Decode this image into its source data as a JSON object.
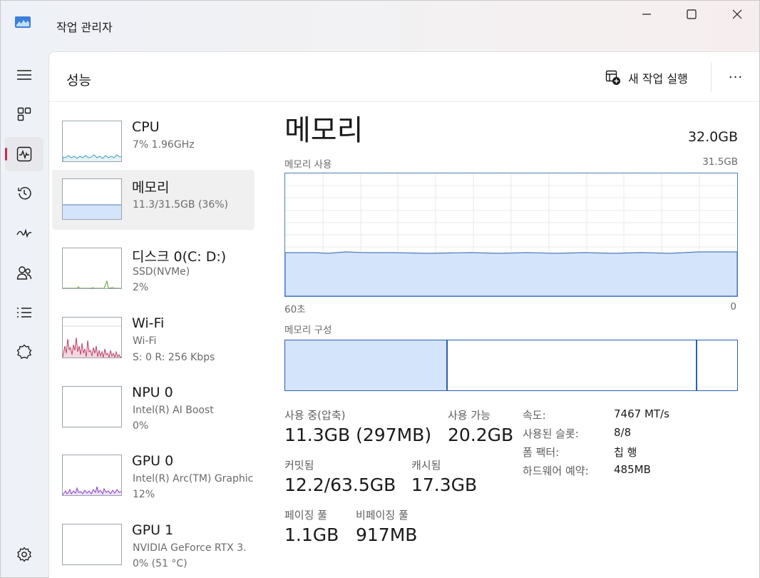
{
  "window": {
    "title": "작업 관리자",
    "colors": {
      "accent": "#c42b4d",
      "memory_line": "#4c7cbf",
      "memory_fill": "#d4e4fa"
    }
  },
  "nav": {
    "items": [
      {
        "icon": "hamburger-menu-icon"
      },
      {
        "icon": "processes-icon"
      },
      {
        "icon": "performance-icon",
        "active": true
      },
      {
        "icon": "app-history-icon"
      },
      {
        "icon": "startup-apps-icon"
      },
      {
        "icon": "users-icon"
      },
      {
        "icon": "details-icon"
      },
      {
        "icon": "services-icon"
      },
      {
        "icon": "settings-icon"
      }
    ]
  },
  "header": {
    "title": "성능",
    "run_task_label": "새 작업 실행",
    "more_label": "···"
  },
  "devices": [
    {
      "name": "CPU",
      "sub1": "7% 1.96GHz",
      "sub2": ""
    },
    {
      "name": "메모리",
      "sub1": "11.3/31.5GB (36%)",
      "sub2": "",
      "selected": true
    },
    {
      "name": "디스크 0(C: D:)",
      "sub1": "SSD(NVMe)",
      "sub2": "2%"
    },
    {
      "name": "Wi-Fi",
      "sub1": "Wi-Fi",
      "sub2": "S: 0 R: 256 Kbps"
    },
    {
      "name": "NPU 0",
      "sub1": "Intel(R) AI Boost",
      "sub2": "0%"
    },
    {
      "name": "GPU 0",
      "sub1": "Intel(R) Arc(TM) Graphic",
      "sub2": "12%"
    },
    {
      "name": "GPU 1",
      "sub1": "NVIDIA GeForce RTX 3.",
      "sub2": "0% (51 °C)"
    }
  ],
  "detail": {
    "title": "메모리",
    "total": "32.0GB",
    "usage_label": "메모리 사용",
    "usage_max": "31.5GB",
    "time_left": "60초",
    "time_right": "0",
    "composition_label": "메모리 구성",
    "usage_fraction": 0.36,
    "stats": {
      "in_use_label": "사용 중(압축)",
      "in_use_value": "11.3GB (297MB)",
      "available_label": "사용 가능",
      "available_value": "20.2GB",
      "committed_label": "커밋됨",
      "committed_value": "12.2/63.5GB",
      "cached_label": "캐시됨",
      "cached_value": "17.3GB",
      "paged_label": "페이징 풀",
      "paged_value": "1.1GB",
      "nonpaged_label": "비페이징 풀",
      "nonpaged_value": "917MB"
    },
    "props": {
      "speed_label": "속도:",
      "speed_value": "7467 MT/s",
      "slots_label": "사용된 슬롯:",
      "slots_value": "8/8",
      "form_label": "폼 팩터:",
      "form_value": "칩 행",
      "reserved_label": "하드웨어 예약:",
      "reserved_value": "485MB"
    }
  }
}
